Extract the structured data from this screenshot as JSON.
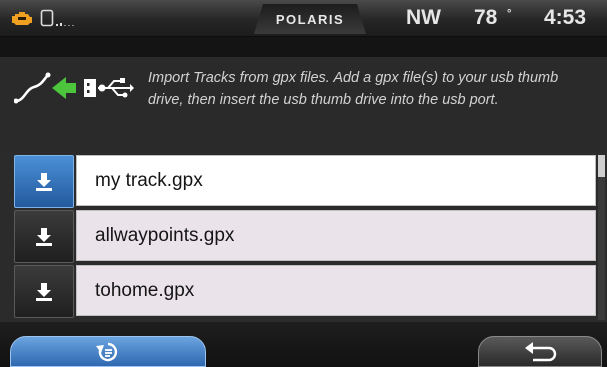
{
  "status_bar": {
    "brand": "POLARIS",
    "heading": "NW",
    "temperature": "78",
    "temperature_unit": "°",
    "clock": "4:53",
    "icons": [
      "engine-warning-icon",
      "phone-icon",
      "signal-icon"
    ]
  },
  "info": {
    "text": "Import Tracks from gpx files. Add a gpx file(s) to your usb thumb drive, then insert the usb thumb drive into the usb port.",
    "icons": [
      "track-icon",
      "import-arrow-icon",
      "usb-icon"
    ]
  },
  "files": [
    {
      "name": "my track.gpx",
      "selected": true
    },
    {
      "name": "allwaypoints.gpx",
      "selected": false
    },
    {
      "name": "tohome.gpx",
      "selected": false
    }
  ],
  "bottom_bar": {
    "left_icon": "route-recalc-icon",
    "right_icon": "back-icon"
  },
  "colors": {
    "accent_blue": "#3a7cc8",
    "engine_icon": "#f0a020",
    "import_arrow": "#4cc43c"
  }
}
